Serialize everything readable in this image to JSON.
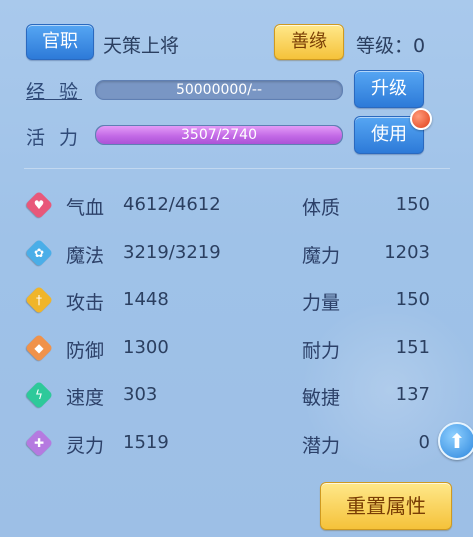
{
  "header": {
    "title_button": "官职",
    "title_value": "天策上将",
    "karma_button": "善缘",
    "level_label": "等级：0"
  },
  "exp": {
    "label": "经 验",
    "bar_text": "50000000/--",
    "upgrade_button": "升级"
  },
  "vitality": {
    "label": "活 力",
    "bar_text": "3507/2740",
    "fill_fraction": 1.0,
    "use_button": "使用"
  },
  "stats": [
    {
      "name": "气血",
      "value": "4612/4612",
      "icon": "heart-icon",
      "color": "#e8587a"
    },
    {
      "name": "魔法",
      "value": "3219/3219",
      "icon": "mana-icon",
      "color": "#4aaee8"
    },
    {
      "name": "攻击",
      "value": "1448",
      "icon": "sword-icon",
      "color": "#f0b52a"
    },
    {
      "name": "防御",
      "value": "1300",
      "icon": "shield-icon",
      "color": "#f0924a"
    },
    {
      "name": "速度",
      "value": "303",
      "icon": "lightning-icon",
      "color": "#2ec99a"
    },
    {
      "name": "灵力",
      "value": "1519",
      "icon": "spirit-icon",
      "color": "#b57ae0"
    }
  ],
  "attributes": [
    {
      "name": "体质",
      "value": "150"
    },
    {
      "name": "魔力",
      "value": "1203"
    },
    {
      "name": "力量",
      "value": "150"
    },
    {
      "name": "耐力",
      "value": "151"
    },
    {
      "name": "敏捷",
      "value": "137"
    },
    {
      "name": "潜力",
      "value": "0"
    }
  ],
  "reset_button": "重置属性",
  "colors": {
    "exp_bar": "#7996c4",
    "vitality_bar": "#c66ee8",
    "accent_blue": "#2d7ad8",
    "accent_gold": "#f5c23a"
  }
}
